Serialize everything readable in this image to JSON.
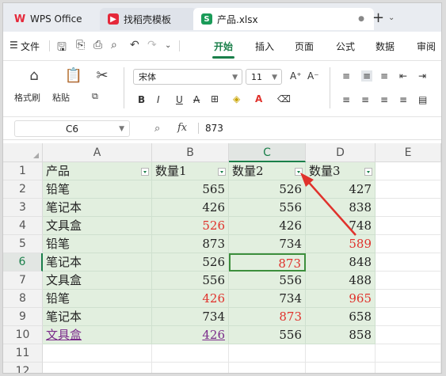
{
  "tabs": {
    "wps": "WPS Office",
    "template": "找稻壳模板",
    "file": "产品.xlsx"
  },
  "menu": {
    "file_label": "文件",
    "items": [
      "开始",
      "插入",
      "页面",
      "公式",
      "数据",
      "审阅"
    ],
    "active": "开始"
  },
  "ribbon": {
    "format_painter": "格式刷",
    "paste": "粘贴",
    "font_name": "宋体",
    "font_size": "11",
    "grow_font": "A⁺",
    "shrink_font": "A⁻",
    "bold": "B",
    "italic": "I",
    "underline": "U",
    "strike": "A"
  },
  "formula_bar": {
    "name_box": "C6",
    "fx": "fx",
    "value": "873"
  },
  "sheet": {
    "columns": [
      "A",
      "B",
      "C",
      "D",
      "E"
    ],
    "selected_column": "C",
    "selected_row": "6",
    "rows": [
      {
        "n": "1",
        "a": "产品",
        "b": "数量1",
        "c": "数量2",
        "d": "数量3"
      },
      {
        "n": "2",
        "a": "铅笔",
        "b": "565",
        "c": "526",
        "d": "427"
      },
      {
        "n": "3",
        "a": "笔记本",
        "b": "426",
        "c": "556",
        "d": "838"
      },
      {
        "n": "4",
        "a": "文具盒",
        "b": "526",
        "c": "426",
        "d": "748"
      },
      {
        "n": "5",
        "a": "铅笔",
        "b": "873",
        "c": "734",
        "d": "589"
      },
      {
        "n": "6",
        "a": "笔记本",
        "b": "526",
        "c": "873",
        "d": "848"
      },
      {
        "n": "7",
        "a": "文具盒",
        "b": "556",
        "c": "556",
        "d": "488"
      },
      {
        "n": "8",
        "a": "铅笔",
        "b": "426",
        "c": "734",
        "d": "965"
      },
      {
        "n": "9",
        "a": "笔记本",
        "b": "734",
        "c": "873",
        "d": "658"
      },
      {
        "n": "10",
        "a": "文具盒",
        "b": "426",
        "c": "556",
        "d": "858"
      },
      {
        "n": "11",
        "a": "",
        "b": "",
        "c": "",
        "d": ""
      },
      {
        "n": "12",
        "a": "",
        "b": "",
        "c": "",
        "d": ""
      }
    ]
  },
  "colors": {
    "accent": "#1a7f4a",
    "red_value": "#e0322c",
    "table_fill": "#e2efdf",
    "arrow": "#e0322c"
  }
}
